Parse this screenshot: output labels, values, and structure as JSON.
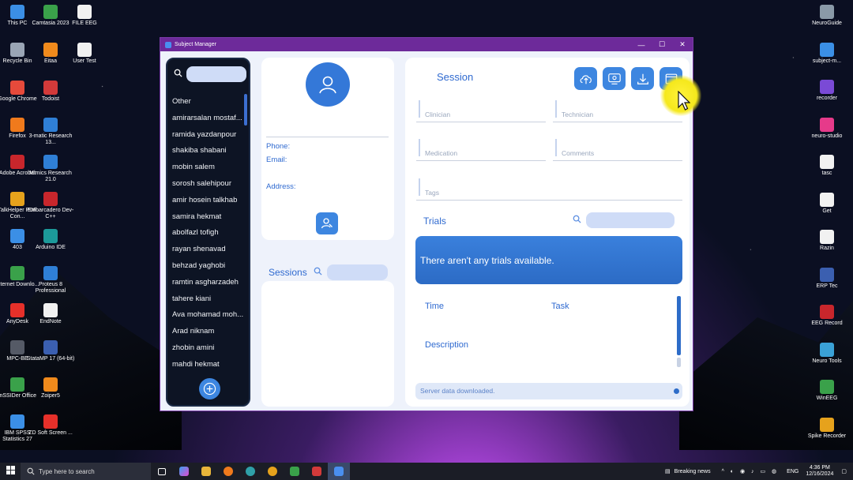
{
  "desktop": {
    "left_icons": [
      {
        "label": "This PC",
        "color": "#3b8fe6"
      },
      {
        "label": "Camtasia 2023",
        "color": "#3aa14a"
      },
      {
        "label": "FILE EEG",
        "color": "#f1f1f1"
      },
      {
        "label": "Recycle Bin",
        "color": "#9aa5b5"
      },
      {
        "label": "Eitaa",
        "color": "#f08a1c"
      },
      {
        "label": "User Test",
        "color": "#f1f1f1"
      },
      {
        "label": "Google Chrome",
        "color": "#e64a3b"
      },
      {
        "label": "Todoist",
        "color": "#d23a3a"
      },
      {
        "label": "Firefox",
        "color": "#f07a1c"
      },
      {
        "label": "3-matic Research 13...",
        "color": "#2f7fd6"
      },
      {
        "label": "Adobe Acrobat",
        "color": "#c8262c"
      },
      {
        "label": "Mimics Research 21.0",
        "color": "#2f7fd6"
      },
      {
        "label": "TalkHelper PDF Con...",
        "color": "#e6a21c"
      },
      {
        "label": "Embarcadero Dev-C++",
        "color": "#c8262c"
      },
      {
        "label": "403",
        "color": "#3b8fe6"
      },
      {
        "label": "Arduino IDE",
        "color": "#1c9a9a"
      },
      {
        "label": "Internet Downlo...",
        "color": "#3aa14a"
      },
      {
        "label": "Proteus 8 Professional",
        "color": "#2f7fd6"
      },
      {
        "label": "AnyDesk",
        "color": "#e6302a"
      },
      {
        "label": "EndNote",
        "color": "#f1f1f1"
      },
      {
        "label": "MPC-BE",
        "color": "#555a66"
      },
      {
        "label": "StataMP 17 (64-bit)",
        "color": "#3b5fb0"
      },
      {
        "label": "inSSIDer Office",
        "color": "#3aa14a"
      },
      {
        "label": "Zoiper5",
        "color": "#f08a1c"
      },
      {
        "label": "IBM SPSS Statistics 27",
        "color": "#3b8fe6"
      },
      {
        "label": "ZD Soft Screen ...",
        "color": "#e6302a"
      }
    ],
    "right_icons": [
      {
        "label": "NeuroGuide",
        "color": "#8a9aa8"
      },
      {
        "label": "subject-m...",
        "color": "#3b8fe6"
      },
      {
        "label": "recorder",
        "color": "#7a4ad6"
      },
      {
        "label": "neuro-studio",
        "color": "#e63a8a"
      },
      {
        "label": "tasc",
        "color": "#f1f1f1"
      },
      {
        "label": "Get",
        "color": "#f1f1f1"
      },
      {
        "label": "Razin",
        "color": "#f1f1f1"
      },
      {
        "label": "ERP Tec",
        "color": "#3b5fb0"
      },
      {
        "label": "EEG Record",
        "color": "#c8262c"
      },
      {
        "label": "Neuro Tools",
        "color": "#3aa1d6"
      },
      {
        "label": "WinEEG",
        "color": "#3aa14a"
      },
      {
        "label": "Spike Recorder",
        "color": "#e6a21c"
      }
    ]
  },
  "window": {
    "title": "Subject Manager",
    "minimize": "—",
    "maximize": "☐",
    "close": "✕",
    "accent": "#6d2a9a"
  },
  "sidebar": {
    "search_placeholder": "",
    "subjects": [
      "Other",
      "amirarsalan mostaf...",
      "ramida yazdanpour",
      "shakiba shabani",
      "mobin salem",
      "sorosh salehipour",
      "amir hosein talkhab",
      "samira hekmat",
      "abolfazl tofigh",
      "rayan shenavad",
      "behzad yaghobi",
      "ramtin asgharzadeh",
      "tahere kiani",
      "Ava mohamad moh...",
      "Arad niknam",
      "zhobin amini",
      "mahdi hekmat"
    ]
  },
  "profile": {
    "phone_label": "Phone:",
    "email_label": "Email:",
    "address_label": "Address:"
  },
  "sessions": {
    "title": "Sessions",
    "search_placeholder": ""
  },
  "session": {
    "title": "Session",
    "fields": {
      "clinician": "Clinician",
      "technician": "Technician",
      "medication": "Medication",
      "comments": "Comments",
      "tags": "Tags"
    }
  },
  "trials": {
    "title": "Trials",
    "search_placeholder": "",
    "empty_message": "There aren't any trials available.",
    "time_label": "Time",
    "task_label": "Task",
    "description_label": "Description"
  },
  "status": {
    "message": "Server data downloaded."
  },
  "taskbar": {
    "search_placeholder": "Type here to search",
    "news": "Breaking news",
    "language": "ENG",
    "time": "4:36 PM",
    "date": "12/16/2024"
  }
}
